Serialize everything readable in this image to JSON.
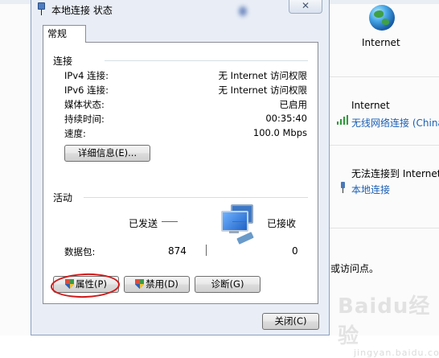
{
  "dialog": {
    "title": "本地连接 状态",
    "tab": "常规",
    "connection": {
      "group_label": "连接",
      "rows": [
        {
          "label": "IPv4 连接:",
          "value": "无 Internet 访问权限"
        },
        {
          "label": "IPv6 连接:",
          "value": "无 Internet 访问权限"
        },
        {
          "label": "媒体状态:",
          "value": "已启用"
        },
        {
          "label": "持续时间:",
          "value": "00:35:40"
        },
        {
          "label": "速度:",
          "value": "100.0 Mbps"
        }
      ],
      "details_button": "详细信息(E)..."
    },
    "activity": {
      "group_label": "活动",
      "sent_label": "已发送",
      "received_label": "已接收",
      "packets_label": "数据包:",
      "packets_sent": "874",
      "packets_received": "0"
    },
    "buttons": {
      "properties": "属性(P)",
      "disable": "禁用(D)",
      "diagnose": "诊断(G)",
      "close": "关闭(C)"
    },
    "close_glyph": "✕"
  },
  "background": {
    "internet_icon_label": "Internet",
    "wireless_title": "Internet",
    "wireless_link": "无线网络连接 (China",
    "local_title": "无法连接到 Internet",
    "local_link": "本地连接",
    "partial_text": "或访问点。",
    "watermark": "Baidu经验",
    "watermark_sub": "jingyan.baidu.com"
  }
}
